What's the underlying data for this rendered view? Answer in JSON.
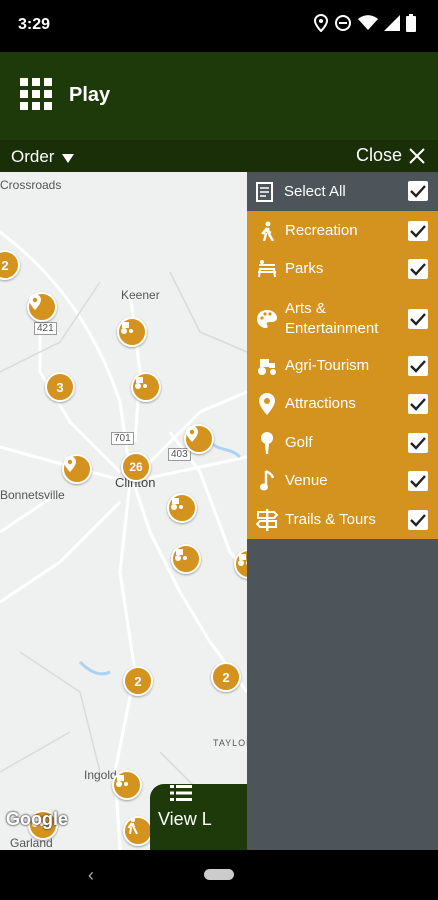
{
  "status_bar": {
    "time": "3:29"
  },
  "app_bar": {
    "title": "Play"
  },
  "sub_bar": {
    "order_label": "Order",
    "close_label": "Close"
  },
  "map": {
    "labels": [
      "Crossroads",
      "Keener",
      "421",
      "701",
      "403",
      "Clinton",
      "Bonnetsville",
      "Ingold",
      "Garland",
      "TAYLOR"
    ],
    "cluster_counts": [
      "2",
      "3",
      "26",
      "2",
      "2"
    ],
    "attribution": "Google"
  },
  "view_list": {
    "label": "View L"
  },
  "filter_panel": {
    "select_all_label": "Select All",
    "categories": [
      {
        "label": "Recreation",
        "checked": true
      },
      {
        "label": "Parks",
        "checked": true
      },
      {
        "label": "Arts & Entertainment",
        "checked": true
      },
      {
        "label": "Agri-Tourism",
        "checked": true
      },
      {
        "label": "Attractions",
        "checked": true
      },
      {
        "label": "Golf",
        "checked": true
      },
      {
        "label": "Venue",
        "checked": true
      },
      {
        "label": "Trails & Tours",
        "checked": true
      }
    ]
  },
  "colors": {
    "app_green": "#1e3a0b",
    "accent_gold": "#d4931f",
    "panel_gray": "#4d545a"
  }
}
